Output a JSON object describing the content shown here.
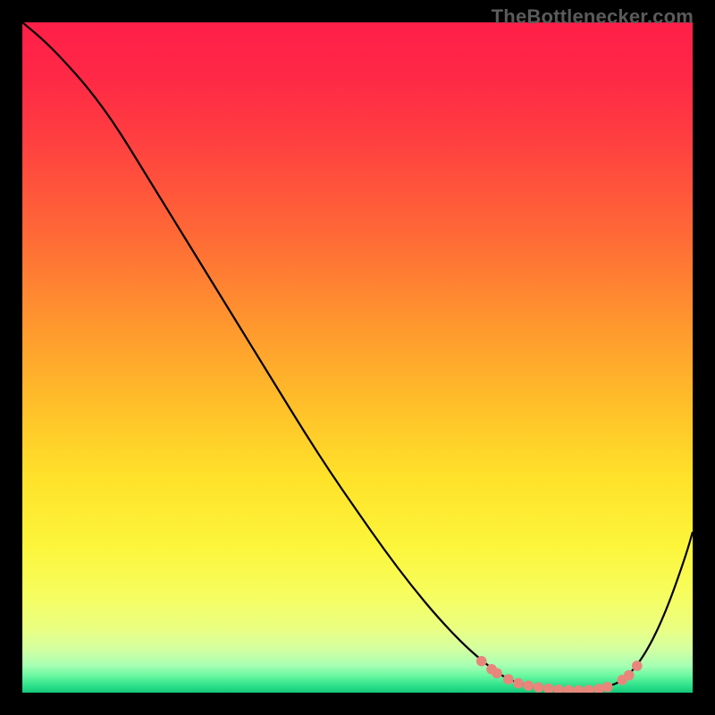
{
  "watermark": "TheBottlenecker.com",
  "chart_data": {
    "type": "line",
    "title": "",
    "xlabel": "",
    "ylabel": "",
    "xlim": [
      0,
      100
    ],
    "ylim": [
      0,
      100
    ],
    "grid": false,
    "background": {
      "type": "vertical-gradient",
      "stops": [
        {
          "offset": 0.0,
          "color": "#ff1f49"
        },
        {
          "offset": 0.08,
          "color": "#ff2846"
        },
        {
          "offset": 0.18,
          "color": "#ff4040"
        },
        {
          "offset": 0.32,
          "color": "#ff6a36"
        },
        {
          "offset": 0.46,
          "color": "#ff9a2e"
        },
        {
          "offset": 0.58,
          "color": "#ffc229"
        },
        {
          "offset": 0.68,
          "color": "#ffe22a"
        },
        {
          "offset": 0.78,
          "color": "#fcf53a"
        },
        {
          "offset": 0.85,
          "color": "#f7fd5c"
        },
        {
          "offset": 0.905,
          "color": "#eaff82"
        },
        {
          "offset": 0.935,
          "color": "#d4ffa2"
        },
        {
          "offset": 0.96,
          "color": "#a5ffb3"
        },
        {
          "offset": 0.975,
          "color": "#69f7a0"
        },
        {
          "offset": 0.99,
          "color": "#2de08a"
        },
        {
          "offset": 1.0,
          "color": "#14c779"
        }
      ]
    },
    "series": [
      {
        "name": "curve",
        "color": "#000000",
        "x": [
          0,
          3,
          6,
          10,
          14,
          18,
          22,
          26,
          30,
          34,
          38,
          42,
          46,
          50,
          54,
          58,
          62,
          66,
          69.5,
          72,
          75,
          78,
          81,
          84,
          87,
          90,
          93,
          96,
          99,
          100
        ],
        "y": [
          100,
          97.5,
          94.5,
          90,
          84.5,
          78,
          71.5,
          65,
          58.5,
          52,
          45.5,
          39,
          32.8,
          27,
          21.3,
          16,
          11.2,
          7,
          4,
          2.2,
          1.1,
          0.55,
          0.35,
          0.35,
          0.7,
          2.0,
          5.8,
          12,
          20.5,
          24
        ]
      }
    ],
    "marker_clusters": [
      {
        "name": "trough-markers",
        "color": "#e9867b",
        "points": [
          {
            "x": 68.5,
            "y": 4.7
          },
          {
            "x": 70.0,
            "y": 3.5
          },
          {
            "x": 70.8,
            "y": 2.9
          },
          {
            "x": 72.5,
            "y": 2.0
          },
          {
            "x": 74.0,
            "y": 1.4
          },
          {
            "x": 75.5,
            "y": 1.05
          },
          {
            "x": 77.0,
            "y": 0.8
          },
          {
            "x": 78.5,
            "y": 0.6
          },
          {
            "x": 80.0,
            "y": 0.45
          },
          {
            "x": 81.5,
            "y": 0.38
          },
          {
            "x": 83.0,
            "y": 0.35
          },
          {
            "x": 84.5,
            "y": 0.4
          },
          {
            "x": 86.0,
            "y": 0.55
          },
          {
            "x": 87.3,
            "y": 0.85
          },
          {
            "x": 89.5,
            "y": 1.9
          },
          {
            "x": 90.5,
            "y": 2.6
          },
          {
            "x": 91.7,
            "y": 4.0
          }
        ]
      }
    ]
  }
}
